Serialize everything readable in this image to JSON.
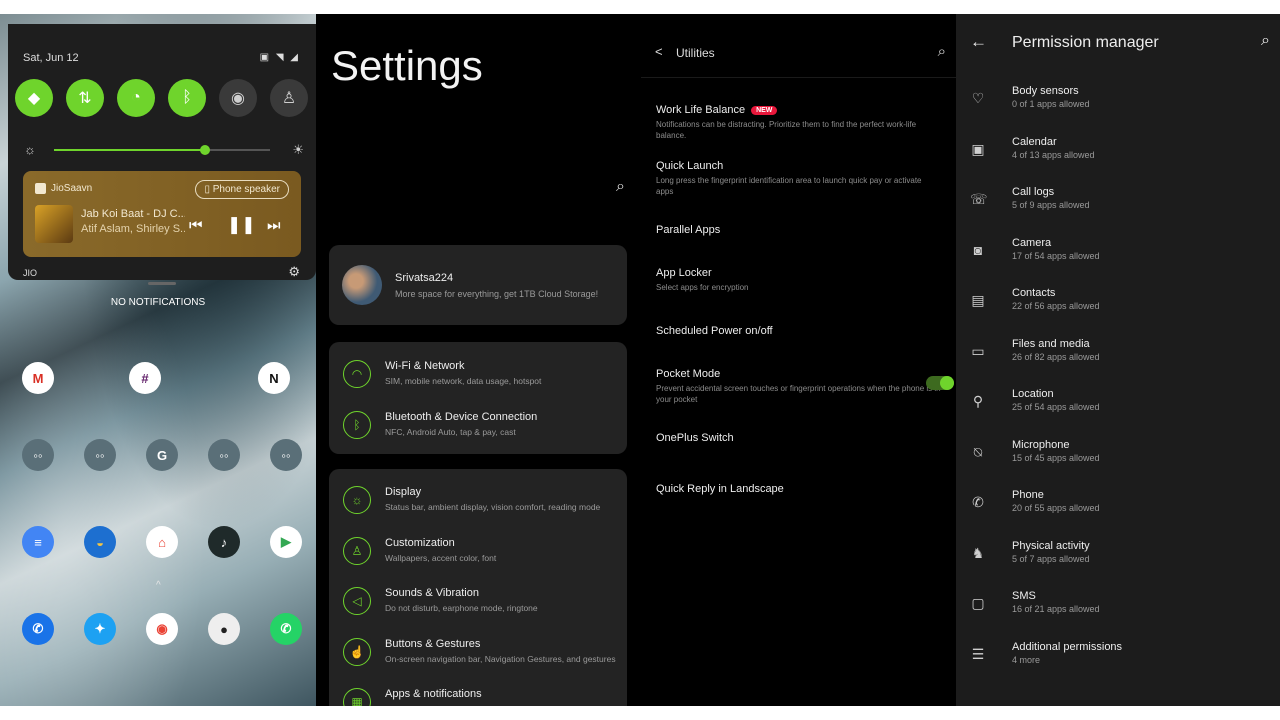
{
  "quick_settings": {
    "date": "Sat, Jun 12",
    "carrier": "JIO",
    "brightness_level": 0.7,
    "tiles": [
      {
        "name": "wifi",
        "on": true
      },
      {
        "name": "data",
        "on": true
      },
      {
        "name": "alarm",
        "on": true
      },
      {
        "name": "bluetooth",
        "on": true
      },
      {
        "name": "record",
        "on": false
      },
      {
        "name": "flashlight",
        "on": false
      }
    ],
    "media": {
      "app": "JioSaavn",
      "output": "Phone speaker",
      "song": "Jab Koi Baat - DJ C...",
      "artist": "Atif Aslam, Shirley S..."
    }
  },
  "home": {
    "no_notifications": "NO NOTIFICATIONS",
    "apps_row1": [
      {
        "icon": "gmail-icon",
        "label": "M",
        "color": "#ffffff",
        "fg": "#d93025"
      },
      {
        "icon": "slack-icon",
        "label": "#",
        "color": "#ffffff",
        "fg": "#611f69"
      },
      {
        "icon": "notion-icon",
        "label": "N",
        "color": "#ffffff",
        "fg": "#111111"
      }
    ],
    "apps_row2": [
      {
        "icon": "social-folder-icon",
        "label": "◦◦",
        "color": "#5a6f78",
        "fg": "#fff"
      },
      {
        "icon": "tools-folder-icon",
        "label": "◦◦",
        "color": "#5a6f78",
        "fg": "#fff"
      },
      {
        "icon": "google-folder-icon",
        "label": "G",
        "color": "#5a6f78",
        "fg": "#fff"
      },
      {
        "icon": "media-folder-icon",
        "label": "◦◦",
        "color": "#5a6f78",
        "fg": "#fff"
      },
      {
        "icon": "misc-folder-icon",
        "label": "◦◦",
        "color": "#5a6f78",
        "fg": "#fff"
      }
    ],
    "apps_row3": [
      {
        "icon": "docs-icon",
        "label": "≡",
        "color": "#4285f4",
        "fg": "#fff"
      },
      {
        "icon": "weather-icon",
        "label": "◒",
        "color": "#1d6fd0",
        "fg": "#f4c542"
      },
      {
        "icon": "google-home-icon",
        "label": "⌂",
        "color": "#ffffff",
        "fg": "#ea4335"
      },
      {
        "icon": "jiosaavn-icon",
        "label": "♪",
        "color": "#1f2a2a",
        "fg": "#fff"
      },
      {
        "icon": "play-store-icon",
        "label": "▶",
        "color": "#ffffff",
        "fg": "#34a853"
      }
    ],
    "apps_row4": [
      {
        "icon": "phone-icon",
        "label": "✆",
        "color": "#1a73e8",
        "fg": "#fff"
      },
      {
        "icon": "twitter-icon",
        "label": "✦",
        "color": "#1da1f2",
        "fg": "#fff"
      },
      {
        "icon": "chrome-icon",
        "label": "◉",
        "color": "#ffffff",
        "fg": "#ea4335"
      },
      {
        "icon": "camera-icon",
        "label": "●",
        "color": "#eeeeee",
        "fg": "#222"
      },
      {
        "icon": "whatsapp-icon",
        "label": "✆",
        "color": "#25d366",
        "fg": "#fff"
      }
    ]
  },
  "settings": {
    "title": "Settings",
    "account": {
      "name": "Srivatsa224",
      "subtitle": "More space for everything, get 1TB Cloud Storage!"
    },
    "group1": [
      {
        "title": "Wi-Fi & Network",
        "sub": "SIM, mobile network, data usage, hotspot",
        "icon": "wifi-icon",
        "glyph": "◠"
      },
      {
        "title": "Bluetooth & Device Connection",
        "sub": "NFC, Android Auto, tap & pay, cast",
        "icon": "bluetooth-icon",
        "glyph": "ᛒ"
      }
    ],
    "group2": [
      {
        "title": "Display",
        "sub": "Status bar, ambient display, vision comfort, reading mode",
        "icon": "display-icon",
        "glyph": "☼"
      },
      {
        "title": "Customization",
        "sub": "Wallpapers, accent color, font",
        "icon": "customization-icon",
        "glyph": "♙"
      },
      {
        "title": "Sounds & Vibration",
        "sub": "Do not disturb, earphone mode, ringtone",
        "icon": "sound-icon",
        "glyph": "◁"
      },
      {
        "title": "Buttons & Gestures",
        "sub": "On-screen navigation bar, Navigation Gestures, and gestures",
        "icon": "gestures-icon",
        "glyph": "☝"
      },
      {
        "title": "Apps & notifications",
        "sub": "",
        "icon": "apps-icon",
        "glyph": "▦"
      }
    ]
  },
  "utilities": {
    "title": "Utilities",
    "items": [
      {
        "title": "Work Life Balance",
        "badge": "NEW",
        "sub": "Notifications can be distracting. Prioritize them to find the perfect work-life balance."
      },
      {
        "title": "Quick Launch",
        "badge": "",
        "sub": "Long press the fingerprint identification area to launch quick pay or activate apps"
      },
      {
        "title": "Parallel Apps",
        "badge": "",
        "sub": ""
      },
      {
        "title": "App Locker",
        "badge": "",
        "sub": "Select apps for encryption"
      },
      {
        "title": "Scheduled Power on/off",
        "badge": "",
        "sub": ""
      },
      {
        "title": "Pocket Mode",
        "badge": "",
        "sub": "Prevent accidental screen touches or fingerprint operations when the phone is in your pocket"
      },
      {
        "title": "OnePlus Switch",
        "badge": "",
        "sub": ""
      },
      {
        "title": "Quick Reply in Landscape",
        "badge": "",
        "sub": ""
      }
    ],
    "pocket_mode_on": true
  },
  "permissions": {
    "title": "Permission manager",
    "items": [
      {
        "name": "Body sensors",
        "count": "0 of 1 apps allowed",
        "icon": "heart-icon",
        "glyph": "♡"
      },
      {
        "name": "Calendar",
        "count": "4 of 13 apps allowed",
        "icon": "calendar-icon",
        "glyph": "▣"
      },
      {
        "name": "Call logs",
        "count": "5 of 9 apps allowed",
        "icon": "call-log-icon",
        "glyph": "☏"
      },
      {
        "name": "Camera",
        "count": "17 of 54 apps allowed",
        "icon": "camera-icon",
        "glyph": "◙"
      },
      {
        "name": "Contacts",
        "count": "22 of 56 apps allowed",
        "icon": "contacts-icon",
        "glyph": "▤"
      },
      {
        "name": "Files and media",
        "count": "26 of 82 apps allowed",
        "icon": "folder-icon",
        "glyph": "▭"
      },
      {
        "name": "Location",
        "count": "25 of 54 apps allowed",
        "icon": "location-icon",
        "glyph": "⚲"
      },
      {
        "name": "Microphone",
        "count": "15 of 45 apps allowed",
        "icon": "microphone-icon",
        "glyph": "⍉"
      },
      {
        "name": "Phone",
        "count": "20 of 55 apps allowed",
        "icon": "phone-icon",
        "glyph": "✆"
      },
      {
        "name": "Physical activity",
        "count": "5 of 7 apps allowed",
        "icon": "activity-icon",
        "glyph": "♞"
      },
      {
        "name": "SMS",
        "count": "16 of 21 apps allowed",
        "icon": "sms-icon",
        "glyph": "▢"
      },
      {
        "name": "Additional permissions",
        "count": "4 more",
        "icon": "list-icon",
        "glyph": "☰"
      }
    ]
  }
}
